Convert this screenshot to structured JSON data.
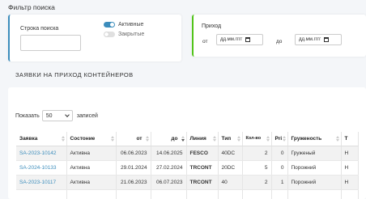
{
  "filter": {
    "title": "Фильтр поиска",
    "search": {
      "label": "Строка поиска",
      "value": ""
    },
    "toggles": [
      {
        "label": "Активные",
        "on": true
      },
      {
        "label": "Закрытые",
        "on": false
      }
    ],
    "arrival": {
      "label": "Приход",
      "from_label": "от",
      "from_placeholder": "дд.мм.гггг",
      "to_label": "до",
      "to_placeholder": "дд.мм.гггг"
    }
  },
  "section": {
    "title": "ЗАЯВКИ НА ПРИХОД КОНТЕЙНЕРОВ"
  },
  "length": {
    "prefix": "Показать",
    "value": "50",
    "suffix": "записей"
  },
  "table": {
    "headers": [
      "Заявка",
      "Состоние",
      "от",
      "до",
      "Линия",
      "Тип",
      "Кол-во",
      "Pri",
      "Груженость",
      "Т"
    ],
    "rows": [
      [
        "SA-2023-10142",
        "Активна",
        "06.06.2023",
        "14.06.2025",
        "FESCO",
        "40DC",
        "2",
        "0",
        "Груженый",
        "Н"
      ],
      [
        "SA-2024-10133",
        "Активна",
        "29.01.2024",
        "27.02.2024",
        "TRCONT",
        "20DC",
        "5",
        "0",
        "Порожний",
        "Н"
      ],
      [
        "SA-2023-10117",
        "Активна",
        "21.06.2023",
        "06.07.2023",
        "TRCONT",
        "40",
        "2",
        "1",
        "Порожний",
        "Н"
      ]
    ]
  },
  "colors": {
    "accent": "#3c8dbc",
    "green": "#52c41a"
  }
}
